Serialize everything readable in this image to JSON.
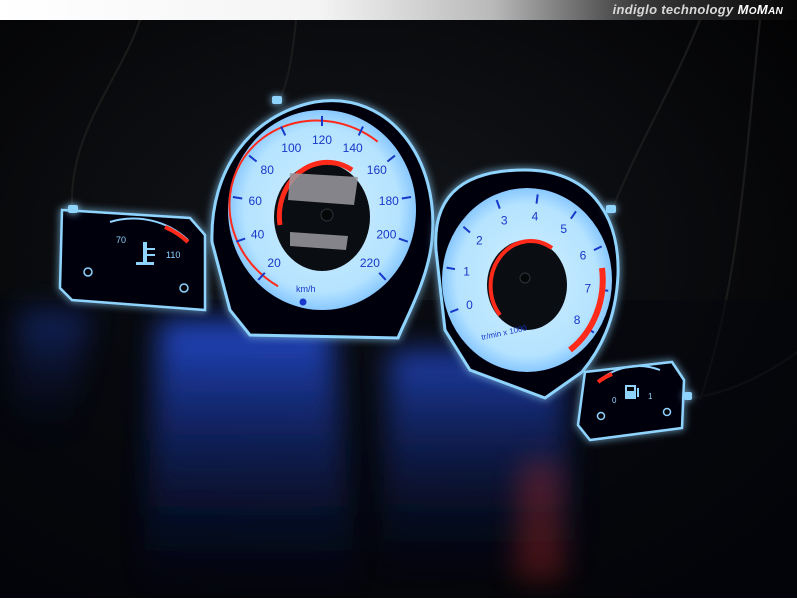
{
  "header": {
    "tagline": "indiglo technology",
    "brand_part1": "M",
    "brand_part2": "O",
    "brand_part3": "M",
    "brand_part4": "AN"
  },
  "colors": {
    "glow": "#8fd3ff",
    "face": "#bfe8ff",
    "red": "#ff2a1a",
    "numeral": "#1738c8",
    "background": "#000000"
  },
  "speedometer": {
    "labels": [
      "20",
      "40",
      "60",
      "80",
      "100",
      "120",
      "140",
      "160",
      "180",
      "200",
      "220"
    ],
    "unit": "km/h"
  },
  "tachometer": {
    "labels": [
      "0",
      "1",
      "2",
      "3",
      "4",
      "5",
      "6",
      "7",
      "8"
    ],
    "unit": "tr/min x 1000"
  },
  "temperature_gauge": {
    "low": "70",
    "high": "110",
    "icon": "coolant-temperature-icon"
  },
  "fuel_gauge": {
    "low": "0",
    "high": "1",
    "icon": "fuel-pump-icon"
  }
}
